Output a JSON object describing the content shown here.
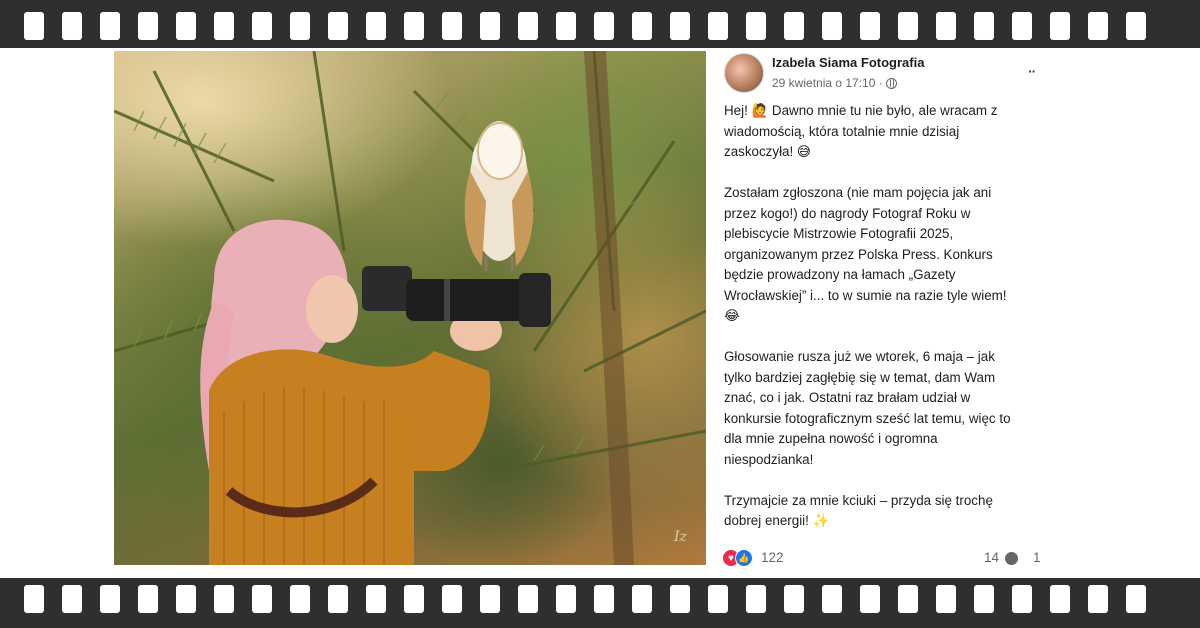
{
  "post": {
    "author": "Izabela Siama Fotografia",
    "timestamp": "29 kwietnia o 17:10 ·",
    "privacy_icon": "globe-icon",
    "more_label": "··",
    "body": [
      [
        "Hej! 🙋 Dawno mnie tu nie było, ale wracam z",
        "wiadomością, która totalnie mnie dzisiaj",
        "zaskoczyła! 😅"
      ],
      [
        "Zostałam zgłoszona (nie mam pojęcia jak ani",
        "przez kogo!) do nagrody Fotograf Roku w",
        "plebiscycie Mistrzowie Fotografii 2025,",
        "organizowanym przez Polska Press. Konkurs",
        "będzie prowadzony na łamach „Gazety",
        "Wrocławskiej” i... to w sumie na razie tyle wiem!",
        "😂"
      ],
      [
        "Głosowanie rusza już we wtorek, 6 maja – jak",
        "tylko bardziej zagłębię się w temat, dam Wam",
        "znać, co i jak. Ostatni raz brałam udział w",
        "konkursie fotograficznym sześć lat temu, więc to",
        "dla mnie zupełna nowość i ogromna",
        "niespodzianka!"
      ],
      [
        "Trzymajcie za mnie kciuki – przyda się trochę",
        "dobrej energii! ✨"
      ]
    ],
    "reactions": {
      "icons": [
        "love-icon",
        "like-icon"
      ],
      "count": "122",
      "comments": "14",
      "shares": "1"
    }
  },
  "photo": {
    "subject": "photo"
  }
}
